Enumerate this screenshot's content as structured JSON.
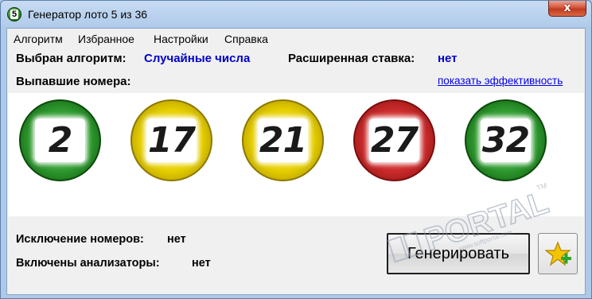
{
  "window": {
    "title": "Генератор лото 5 из 36",
    "close_glyph": "x"
  },
  "menu": [
    {
      "label": "Алгоритм"
    },
    {
      "label": "Избранное"
    },
    {
      "label": "Настройки"
    },
    {
      "label": "Справка"
    }
  ],
  "info": {
    "algorithm_label": "Выбран алгоритм:",
    "algorithm_value": "Случайные числа",
    "extended_label": "Расширенная ставка:",
    "extended_value": "нет",
    "drawn_label": "Выпавшие номера:",
    "efficiency_link": "показать эффективность"
  },
  "balls": [
    {
      "number": "2",
      "color": "green"
    },
    {
      "number": "17",
      "color": "yellow"
    },
    {
      "number": "21",
      "color": "yellow"
    },
    {
      "number": "27",
      "color": "red"
    },
    {
      "number": "32",
      "color": "green"
    }
  ],
  "bottom": {
    "exclusion_label": "Исключение номеров:",
    "exclusion_value": "нет",
    "analyzers_label": "Включены анализаторы:",
    "analyzers_value": "нет",
    "generate_label": "Генерировать"
  },
  "watermark": {
    "text": "PORTAL",
    "tm": "TM",
    "sub": "www.softportal.com"
  },
  "icons": {
    "app": "lotto-ball-5-icon",
    "favorite": "star-add-icon"
  },
  "colors": {
    "link": "#0000ee",
    "value_blue": "#0000cc",
    "close": "#c03a1f"
  }
}
